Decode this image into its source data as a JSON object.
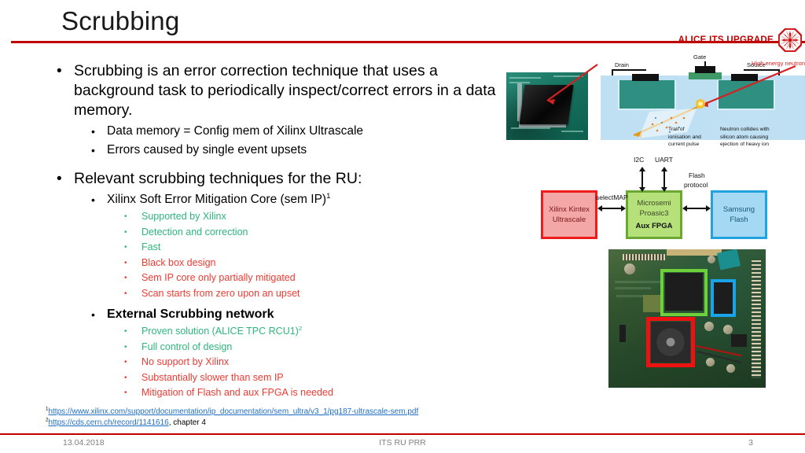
{
  "slide": {
    "title": "Scrubbing",
    "accent_color": "#c00000",
    "pro_color": "#2eb67d",
    "con_color": "#ee3b33"
  },
  "logo": {
    "text": "ALICE ITS UPGRADE",
    "mark": "octagon-starburst-icon"
  },
  "bullets": {
    "b1": "Scrubbing is an error correction technique that uses a background task to periodically inspect/correct errors  in a data memory.",
    "b1_sub1": "Data memory = Config mem of Xilinx Ultrascale",
    "b1_sub2": "Errors caused by single event upsets",
    "b2": "Relevant scrubbing techniques for the RU:",
    "sem_ip": "Xilinx Soft Error Mitigation Core (sem IP)",
    "sem_ip_note": "1",
    "sem_points": [
      {
        "text": "Supported by Xilinx",
        "kind": "pro"
      },
      {
        "text": "Detection and correction",
        "kind": "pro"
      },
      {
        "text": "Fast",
        "kind": "pro"
      },
      {
        "text": "Black box design",
        "kind": "con"
      },
      {
        "text": "Sem IP core only partially mitigated",
        "kind": "con"
      },
      {
        "text": "Scan starts from zero upon an upset",
        "kind": "con"
      }
    ],
    "external": "External Scrubbing network",
    "ext_points": [
      {
        "text": "Proven solution (ALICE TPC RCU1)",
        "note": "2",
        "kind": "pro"
      },
      {
        "text": "Full control of design",
        "note": "",
        "kind": "pro"
      },
      {
        "text": "No support by Xilinx",
        "note": "",
        "kind": "con"
      },
      {
        "text": "Substantially slower than sem IP",
        "note": "",
        "kind": "con"
      },
      {
        "text": "Mitigation of Flash and aux FPGA is needed",
        "note": "",
        "kind": "con"
      }
    ]
  },
  "footnotes": {
    "marker1": "1",
    "link1": "https://www.xilinx.com/support/documentation/ip_documentation/sem_ultra/v3_1/pg187-ultrascale-sem.pdf",
    "marker2": "2",
    "link2": "https://cds.cern.ch/record/1141616",
    "suffix2": ", chapter 4"
  },
  "footer": {
    "date": "13.04.2018",
    "center": "ITS RU PRR",
    "page": "3"
  },
  "figures": {
    "seu": {
      "neutron_label": "High energy neutron",
      "gate": "Gate",
      "drain": "Drain",
      "source": "Source",
      "caption_left": "Trail of\nionisation and\ncurrent pulse",
      "caption_right": "Neutron collides with\nsilicon atom causing\nejection of heavy ion"
    },
    "blocks": {
      "kintex": "Xilinx Kintex\nUltrascale",
      "aux_line1": "Microsemi",
      "aux_line2": "Proasic3",
      "aux_label": "Aux FPGA",
      "flash_line1": "Samsung",
      "flash_line2": "Flash",
      "selectmap": "selectMAP",
      "i2c": "I2C",
      "uart": "UART",
      "flash_protocol_line1": "Flash",
      "flash_protocol_line2": "protocol"
    },
    "pcb": {
      "name": "readout-unit-board-photo"
    }
  }
}
